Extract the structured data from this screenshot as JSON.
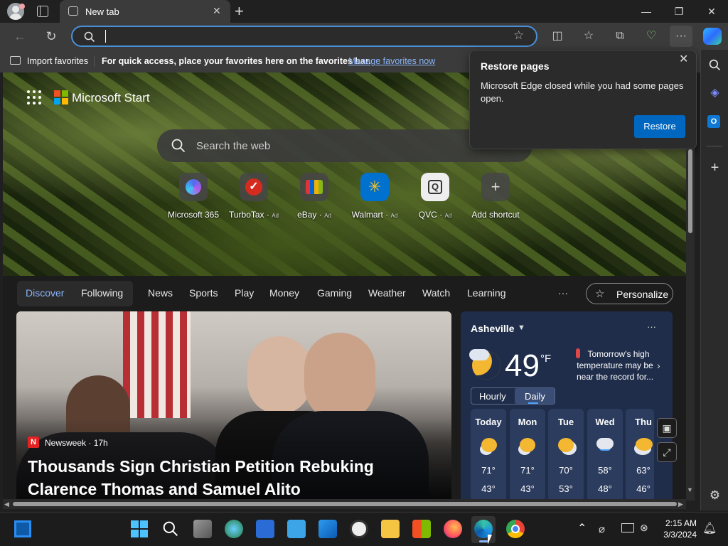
{
  "tab": {
    "title": "New tab"
  },
  "address": {
    "value": "",
    "placeholder": ""
  },
  "favorites_bar": {
    "import_label": "Import favorites",
    "message": "For quick access, place your favorites here on the favorites bar.",
    "manage_link": "Manage favorites now"
  },
  "hero": {
    "brand": "Microsoft Start",
    "search_placeholder": "Search the web",
    "quick_links": [
      {
        "label": "Microsoft 365",
        "ad": ""
      },
      {
        "label": "TurboTax",
        "ad": "Ad"
      },
      {
        "label": "eBay",
        "ad": "Ad"
      },
      {
        "label": "Walmart",
        "ad": "Ad"
      },
      {
        "label": "QVC",
        "ad": "Ad"
      },
      {
        "label": "Add shortcut",
        "ad": ""
      }
    ]
  },
  "nav": {
    "tabs": [
      "Discover",
      "Following"
    ],
    "items": [
      "News",
      "Sports",
      "Play",
      "Money",
      "Gaming",
      "Weather",
      "Watch",
      "Learning"
    ],
    "more": "···",
    "personalize": "Personalize"
  },
  "news": {
    "source": "Newsweek",
    "time": "17h",
    "source_badge": "N",
    "headline": "Thousands Sign Christian Petition Rebuking Clarence Thomas and Samuel Alito"
  },
  "weather": {
    "location": "Asheville",
    "temp": "49",
    "unit": "°F",
    "alert": "Tomorrow's high temperature may be near the record for...",
    "toggle": [
      "Hourly",
      "Daily"
    ],
    "days": [
      {
        "name": "Today",
        "high": "71°",
        "low": "43°"
      },
      {
        "name": "Mon",
        "high": "71°",
        "low": "43°"
      },
      {
        "name": "Tue",
        "high": "70°",
        "low": "53°"
      },
      {
        "name": "Wed",
        "high": "58°",
        "low": "48°"
      },
      {
        "name": "Thu",
        "high": "63°",
        "low": "46°"
      }
    ]
  },
  "popup": {
    "title": "Restore pages",
    "body": "Microsoft Edge closed while you had some pages open.",
    "button": "Restore"
  },
  "taskbar": {
    "time": "2:15 AM",
    "date": "3/3/2024"
  },
  "colors": {
    "accent": "#0067c0",
    "link": "#8ab4f8",
    "address_border": "#4a90d9"
  }
}
